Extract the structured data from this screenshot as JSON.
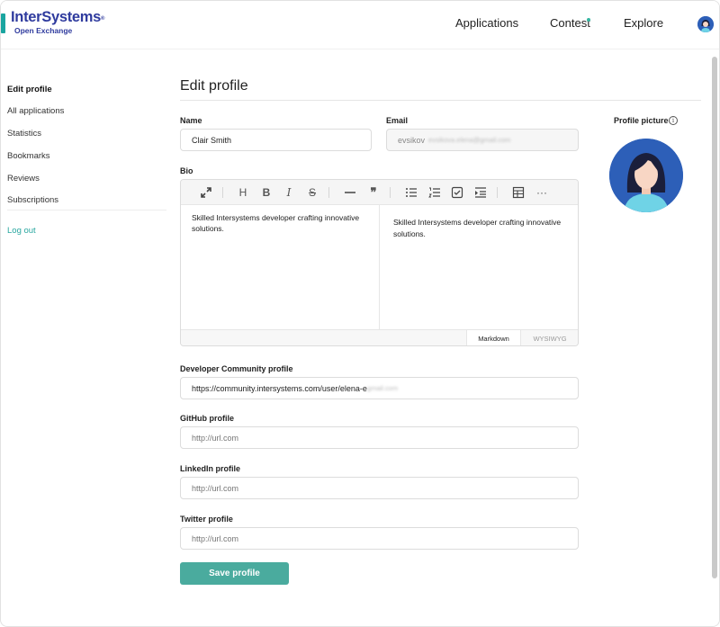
{
  "header": {
    "logo_main": "InterSystems",
    "logo_mark": "®",
    "logo_sub": "Open Exchange",
    "nav": {
      "applications": "Applications",
      "contest": "Contest",
      "explore": "Explore"
    }
  },
  "sidebar": {
    "items": [
      {
        "label": "Edit profile"
      },
      {
        "label": "All applications"
      },
      {
        "label": "Statistics"
      },
      {
        "label": "Bookmarks"
      },
      {
        "label": "Reviews"
      },
      {
        "label": "Subscriptions"
      }
    ],
    "logout": "Log out"
  },
  "page": {
    "title": "Edit profile"
  },
  "form": {
    "name_label": "Name",
    "name_value": "Clair Smith",
    "email_label": "Email",
    "email_value": "evsikov",
    "email_blurred": "evsikova.elena@gmail.com",
    "bio_label": "Bio",
    "bio_text": "Skilled Intersystems developer crafting innovative solutions.",
    "bio_preview": "Skilled Intersystems developer crafting innovative solutions.",
    "editor_modes": {
      "markdown": "Markdown",
      "wysiwyg": "WYSIWYG"
    },
    "dc_label": "Developer Community profile",
    "dc_value": "https://community.intersystems.com/user/elena-e",
    "dc_blurred": "gmail.com",
    "github_label": "GitHub profile",
    "github_placeholder": "http://url.com",
    "linkedin_label": "LinkedIn profile",
    "linkedin_placeholder": "http://url.com",
    "twitter_label": "Twitter profile",
    "twitter_placeholder": "http://url.com",
    "save_label": "Save profile"
  },
  "profile_picture": {
    "label": "Profile picture",
    "info_glyph": "i"
  },
  "colors": {
    "brand": "#2f3b9e",
    "accent": "#4aab9e",
    "avatar_bg": "#2d5fb8",
    "dot": "#36b6a2"
  },
  "icons": [
    "fullscreen-icon",
    "heading-icon",
    "bold-icon",
    "italic-icon",
    "strikethrough-icon",
    "horizontal-rule-icon",
    "quote-icon",
    "bullet-list-icon",
    "ordered-list-icon",
    "task-list-icon",
    "indent-icon",
    "table-icon",
    "more-icon",
    "info-icon"
  ]
}
